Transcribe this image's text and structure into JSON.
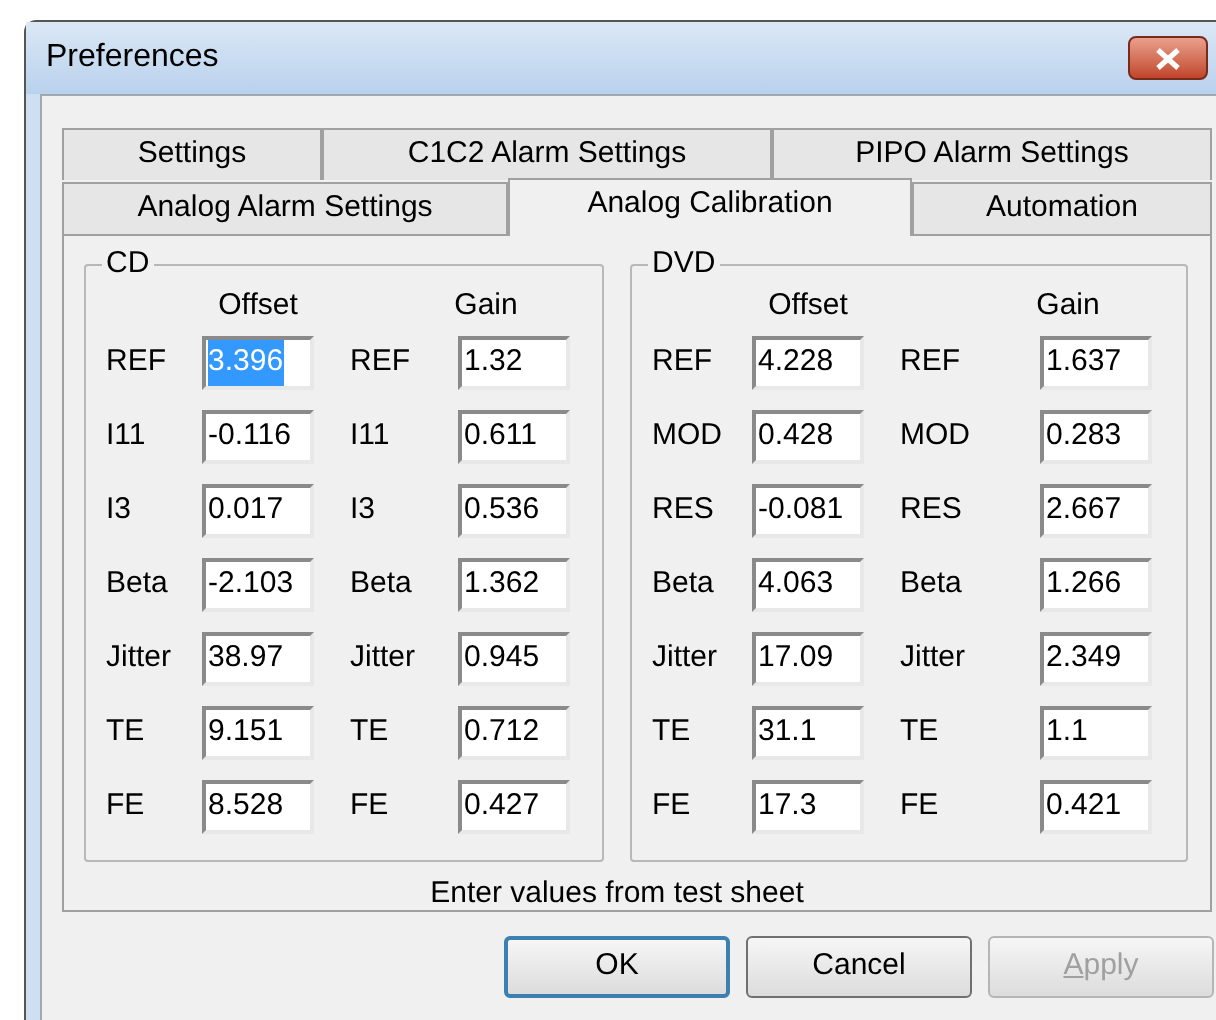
{
  "window": {
    "title": "Preferences"
  },
  "tab_rows": [
    [
      {
        "label": "Settings",
        "selected": false
      },
      {
        "label": "C1C2 Alarm Settings",
        "selected": false
      },
      {
        "label": "PIPO Alarm Settings",
        "selected": false
      }
    ],
    [
      {
        "label": "Analog Alarm Settings",
        "selected": false
      },
      {
        "label": "Analog Calibration",
        "selected": true
      },
      {
        "label": "Automation",
        "selected": false
      }
    ]
  ],
  "groups": [
    {
      "title": "CD",
      "columns": [
        "Offset",
        "Gain"
      ],
      "rows": [
        {
          "cells": [
            {
              "label": "REF",
              "value": "3.396",
              "selected": true
            },
            {
              "label": "REF",
              "value": "1.32",
              "selected": false
            }
          ]
        },
        {
          "cells": [
            {
              "label": "I11",
              "value": "-0.116",
              "selected": false
            },
            {
              "label": "I11",
              "value": "0.611",
              "selected": false
            }
          ]
        },
        {
          "cells": [
            {
              "label": "I3",
              "value": "0.017",
              "selected": false
            },
            {
              "label": "I3",
              "value": "0.536",
              "selected": false
            }
          ]
        },
        {
          "cells": [
            {
              "label": "Beta",
              "value": "-2.103",
              "selected": false
            },
            {
              "label": "Beta",
              "value": "1.362",
              "selected": false
            }
          ]
        },
        {
          "cells": [
            {
              "label": "Jitter",
              "value": "38.97",
              "selected": false
            },
            {
              "label": "Jitter",
              "value": "0.945",
              "selected": false
            }
          ]
        },
        {
          "cells": [
            {
              "label": "TE",
              "value": "9.151",
              "selected": false
            },
            {
              "label": "TE",
              "value": "0.712",
              "selected": false
            }
          ]
        },
        {
          "cells": [
            {
              "label": "FE",
              "value": "8.528",
              "selected": false
            },
            {
              "label": "FE",
              "value": "0.427",
              "selected": false
            }
          ]
        }
      ]
    },
    {
      "title": "DVD",
      "columns": [
        "Offset",
        "Gain"
      ],
      "rows": [
        {
          "cells": [
            {
              "label": "REF",
              "value": "4.228",
              "selected": false
            },
            {
              "label": "REF",
              "value": "1.637",
              "selected": false
            }
          ]
        },
        {
          "cells": [
            {
              "label": "MOD",
              "value": "0.428",
              "selected": false
            },
            {
              "label": "MOD",
              "value": "0.283",
              "selected": false
            }
          ]
        },
        {
          "cells": [
            {
              "label": "RES",
              "value": "-0.081",
              "selected": false
            },
            {
              "label": "RES",
              "value": "2.667",
              "selected": false
            }
          ]
        },
        {
          "cells": [
            {
              "label": "Beta",
              "value": "4.063",
              "selected": false
            },
            {
              "label": "Beta",
              "value": "1.266",
              "selected": false
            }
          ]
        },
        {
          "cells": [
            {
              "label": "Jitter",
              "value": "17.09",
              "selected": false
            },
            {
              "label": "Jitter",
              "value": "2.349",
              "selected": false
            }
          ]
        },
        {
          "cells": [
            {
              "label": "TE",
              "value": "31.1",
              "selected": false
            },
            {
              "label": "TE",
              "value": "1.1",
              "selected": false
            }
          ]
        },
        {
          "cells": [
            {
              "label": "FE",
              "value": "17.3",
              "selected": false
            },
            {
              "label": "FE",
              "value": "0.421",
              "selected": false
            }
          ]
        }
      ]
    }
  ],
  "hint": "Enter values from test sheet",
  "buttons": [
    {
      "label": "OK",
      "default": true,
      "disabled": false
    },
    {
      "label": "Cancel",
      "default": false,
      "disabled": false
    },
    {
      "label": "Apply",
      "default": false,
      "disabled": true
    }
  ]
}
